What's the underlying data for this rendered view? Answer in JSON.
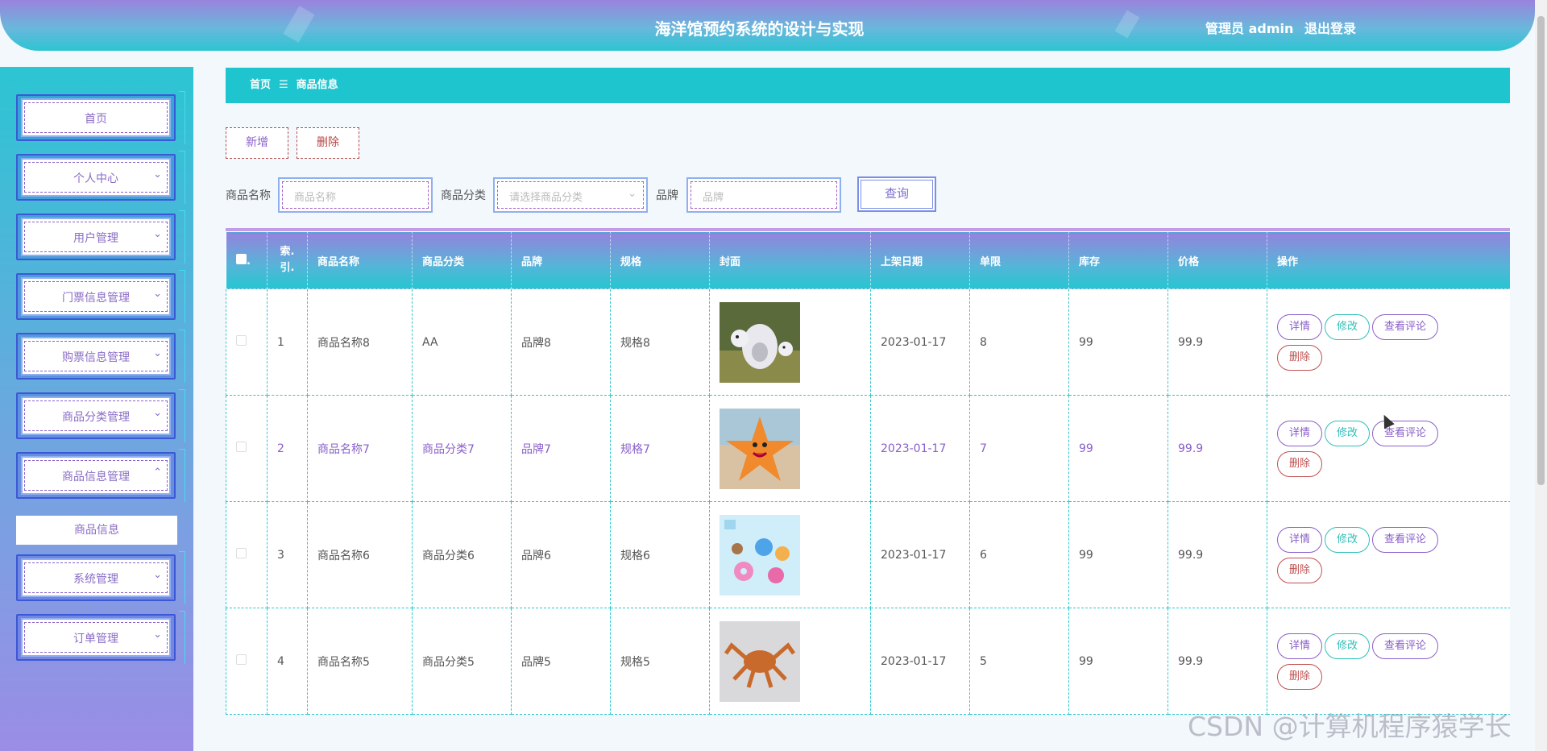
{
  "header": {
    "title": "海洋馆预约系统的设计与实现",
    "user_label": "管理员 admin",
    "logout": "退出登录"
  },
  "sidebar": {
    "items": [
      {
        "label": "首页",
        "chevron": ""
      },
      {
        "label": "个人中心",
        "chevron": "⌄"
      },
      {
        "label": "用户管理",
        "chevron": "⌄"
      },
      {
        "label": "门票信息管理",
        "chevron": "⌄"
      },
      {
        "label": "购票信息管理",
        "chevron": "⌄"
      },
      {
        "label": "商品分类管理",
        "chevron": "⌄"
      },
      {
        "label": "商品信息管理",
        "chevron": "⌃"
      },
      {
        "label": "系统管理",
        "chevron": "⌄"
      },
      {
        "label": "订单管理",
        "chevron": "⌄"
      }
    ],
    "submenu": "商品信息"
  },
  "breadcrumb": {
    "home": "首页",
    "sep": "☰",
    "current": "商品信息"
  },
  "toolbar": {
    "add": "新增",
    "delete": "删除"
  },
  "search": {
    "name_label": "商品名称",
    "name_placeholder": "商品名称",
    "category_label": "商品分类",
    "category_placeholder": "请选择商品分类",
    "brand_label": "品牌",
    "brand_placeholder": "品牌",
    "query": "查询"
  },
  "table": {
    "headers": [
      "",
      "索引",
      "商品名称",
      "商品分类",
      "品牌",
      "规格",
      "封面",
      "上架日期",
      "单限",
      "库存",
      "价格",
      "操作"
    ],
    "index_header_top": "索.",
    "index_header_bottom": "引.",
    "rows": [
      {
        "idx": "1",
        "name": "商品名称8",
        "category": "AA",
        "brand": "品牌8",
        "spec": "规格8",
        "cover": "ghost-figure",
        "date": "2023-01-17",
        "limit": "8",
        "stock": "99",
        "price": "99.9"
      },
      {
        "idx": "2",
        "name": "商品名称7",
        "category": "商品分类7",
        "brand": "品牌7",
        "spec": "规格7",
        "cover": "starfish-plush",
        "date": "2023-01-17",
        "limit": "7",
        "stock": "99",
        "price": "99.9"
      },
      {
        "idx": "3",
        "name": "商品名称6",
        "category": "商品分类6",
        "brand": "品牌6",
        "spec": "规格6",
        "cover": "sea-toys",
        "date": "2023-01-17",
        "limit": "6",
        "stock": "99",
        "price": "99.9"
      },
      {
        "idx": "4",
        "name": "商品名称5",
        "category": "商品分类5",
        "brand": "品牌5",
        "spec": "规格5",
        "cover": "crab-plush",
        "date": "2023-01-17",
        "limit": "5",
        "stock": "99",
        "price": "99.9"
      }
    ],
    "ops": {
      "detail": "详情",
      "edit": "修改",
      "comments": "查看评论",
      "delete": "删除"
    }
  },
  "watermark": "CSDN @计算机程序猿学长",
  "colors": {
    "accent": "#1ec5cf",
    "purple": "#8a5fc9",
    "danger": "#c05050"
  }
}
